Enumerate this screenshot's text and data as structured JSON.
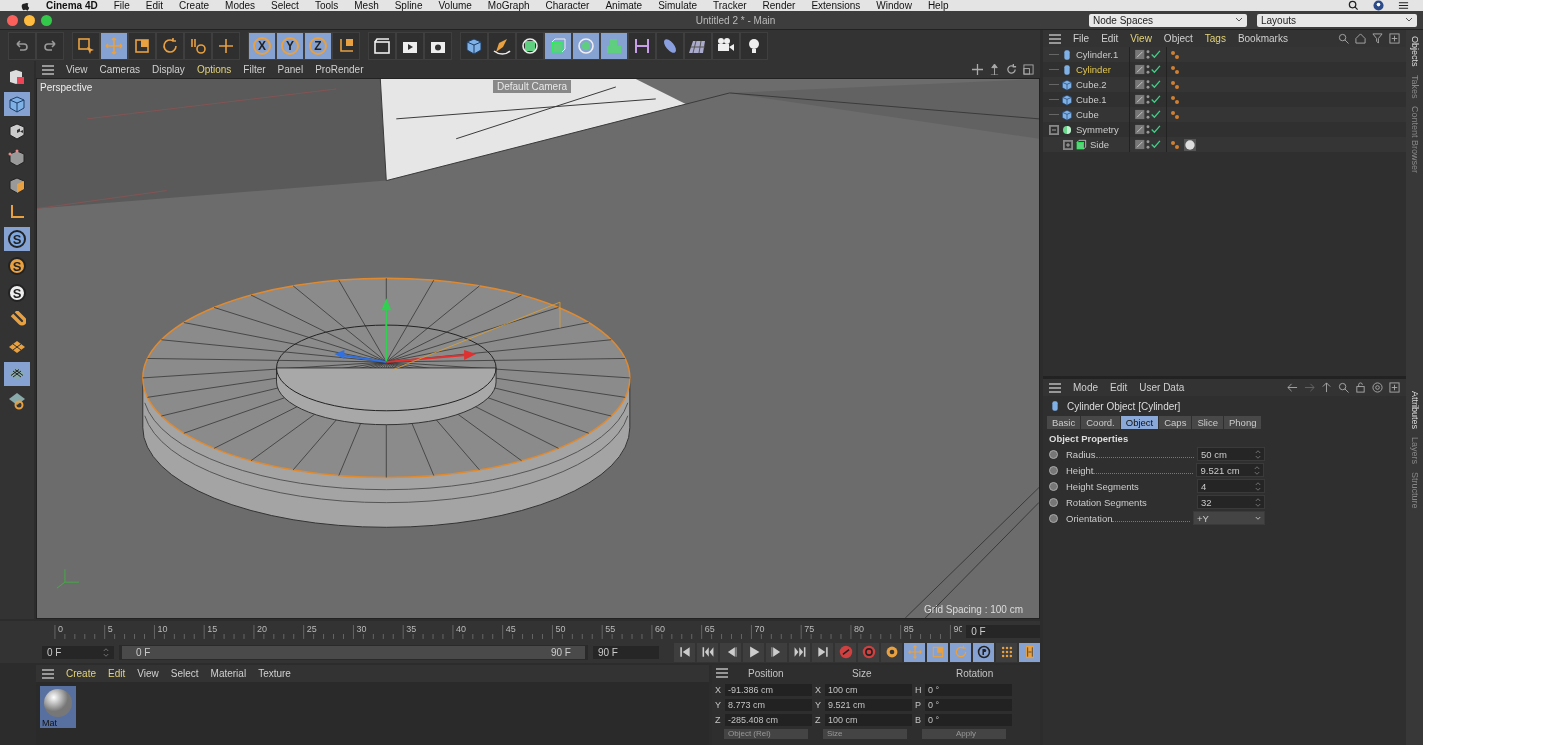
{
  "menubar": {
    "app": "Cinema 4D",
    "menus": [
      "File",
      "Edit",
      "Create",
      "Modes",
      "Select",
      "Tools",
      "Mesh",
      "Spline",
      "Volume",
      "MoGraph",
      "Character",
      "Animate",
      "Simulate",
      "Tracker",
      "Render",
      "Extensions",
      "Window",
      "Help"
    ]
  },
  "window": {
    "title": "Untitled 2 * - Main"
  },
  "node_spaces": "Node Spaces",
  "layouts": "Layouts",
  "toolbar": [
    [
      {
        "kind": "undo",
        "selected": false
      },
      {
        "kind": "redo",
        "selected": false
      }
    ],
    [
      {
        "kind": "select",
        "selected": false
      },
      {
        "kind": "move",
        "selected": true
      },
      {
        "kind": "scale",
        "selected": false
      },
      {
        "kind": "rotate",
        "selected": false
      },
      {
        "kind": "psr",
        "selected": false
      },
      {
        "kind": "add",
        "selected": false
      }
    ],
    [
      {
        "kind": "axis",
        "label": "X",
        "selected": true
      },
      {
        "kind": "axis",
        "label": "Y",
        "selected": true
      },
      {
        "kind": "axis",
        "label": "Z",
        "selected": true
      },
      {
        "kind": "coord",
        "selected": false
      }
    ],
    [
      {
        "kind": "clapper",
        "selected": false
      },
      {
        "kind": "render",
        "selected": false
      },
      {
        "kind": "render-settings",
        "selected": false
      }
    ],
    [
      {
        "kind": "cube",
        "selected": false
      },
      {
        "kind": "pen",
        "selected": false
      },
      {
        "kind": "subdiv",
        "selected": false
      },
      {
        "kind": "extrude",
        "selected": true
      },
      {
        "kind": "mograph",
        "selected": true
      },
      {
        "kind": "cloner",
        "selected": true
      },
      {
        "kind": "deformer",
        "selected": false
      },
      {
        "kind": "field",
        "selected": false
      },
      {
        "kind": "floor",
        "selected": false
      },
      {
        "kind": "camera",
        "selected": false
      },
      {
        "kind": "light",
        "selected": false
      }
    ]
  ],
  "left_tools": [
    {
      "kind": "editable",
      "selected": false
    },
    {
      "kind": "cube",
      "selected": true
    },
    {
      "kind": "texture",
      "selected": false
    },
    {
      "kind": "points",
      "selected": false
    },
    {
      "kind": "polygons",
      "selected": false
    },
    {
      "kind": "corner",
      "selected": false
    },
    {
      "kind": "snap",
      "label": "S",
      "selected": true
    },
    {
      "kind": "snap",
      "label": "S",
      "selected": false
    },
    {
      "kind": "snap",
      "label": "S",
      "selected": false
    },
    {
      "kind": "magnet",
      "selected": false
    },
    {
      "kind": "workplane",
      "selected": false
    },
    {
      "kind": "grid",
      "selected": true
    },
    {
      "kind": "lock",
      "selected": false
    }
  ],
  "viewport": {
    "menus": [
      {
        "label": "View",
        "active": false
      },
      {
        "label": "Cameras",
        "active": false
      },
      {
        "label": "Display",
        "active": false
      },
      {
        "label": "Options",
        "active": true
      },
      {
        "label": "Filter",
        "active": false
      },
      {
        "label": "Panel",
        "active": false
      },
      {
        "label": "ProRender",
        "active": false
      }
    ],
    "name": "Perspective",
    "camera": "Default Camera",
    "grid_spacing": "Grid Spacing : 100 cm"
  },
  "timeline": {
    "ticks": [
      "0",
      "5",
      "10",
      "15",
      "20",
      "25",
      "30",
      "35",
      "40",
      "45",
      "50",
      "55",
      "60",
      "65",
      "70",
      "75",
      "80",
      "85",
      "90"
    ],
    "current": "0 F",
    "start": "0 F",
    "range": {
      "level": 1
    },
    "range_start": "0 F",
    "range_end": "90 F",
    "end": "90 F",
    "controls": [
      {
        "kind": "first",
        "selected": false
      },
      {
        "kind": "prev-key",
        "selected": false
      },
      {
        "kind": "prev",
        "selected": false
      },
      {
        "kind": "play",
        "selected": false
      },
      {
        "kind": "next",
        "selected": false
      },
      {
        "kind": "next-key",
        "selected": false
      },
      {
        "kind": "last",
        "selected": false
      },
      {
        "kind": "record",
        "selected": false
      },
      {
        "kind": "autokey",
        "selected": false
      },
      {
        "kind": "keysel",
        "selected": false
      },
      {
        "kind": "move",
        "selected": true
      },
      {
        "kind": "scale",
        "selected": true
      },
      {
        "kind": "rotate",
        "selected": true
      },
      {
        "kind": "param",
        "selected": true
      },
      {
        "kind": "dots",
        "selected": false
      },
      {
        "kind": "film",
        "selected": true
      }
    ]
  },
  "material": {
    "menus": [
      {
        "label": "Create",
        "active": true
      },
      {
        "label": "Edit",
        "active": true
      },
      {
        "label": "View",
        "active": false
      },
      {
        "label": "Select",
        "active": false
      },
      {
        "label": "Material",
        "active": false
      },
      {
        "label": "Texture",
        "active": false
      }
    ],
    "materials": [
      {
        "name": "Mat",
        "selected": true
      }
    ]
  },
  "coordinates": {
    "headers": [
      "Position",
      "Size",
      "Rotation"
    ],
    "rows": [
      {
        "cells": [
          {
            "axis": "X",
            "value": "-91.386 cm"
          },
          {
            "axis": "X",
            "value": "100 cm"
          },
          {
            "axis": "H",
            "value": "0 °"
          }
        ]
      },
      {
        "cells": [
          {
            "axis": "Y",
            "value": "8.773 cm"
          },
          {
            "axis": "Y",
            "value": "9.521 cm"
          },
          {
            "axis": "P",
            "value": "0 °"
          }
        ]
      },
      {
        "cells": [
          {
            "axis": "Z",
            "value": "-285.408 cm"
          },
          {
            "axis": "Z",
            "value": "100 cm"
          },
          {
            "axis": "B",
            "value": "0 °"
          }
        ]
      }
    ],
    "footer": [
      "Object (Rel)",
      "Size",
      "Apply"
    ]
  },
  "objects": {
    "menus": [
      {
        "label": "File",
        "active": false
      },
      {
        "label": "Edit",
        "active": false
      },
      {
        "label": "View",
        "active": true
      },
      {
        "label": "Object",
        "active": false
      },
      {
        "label": "Tags",
        "active": true
      },
      {
        "label": "Bookmarks",
        "active": false
      }
    ],
    "items": [
      {
        "name": "Cylinder.1",
        "kind": "cylinder",
        "selected": false,
        "phong_tag": true,
        "material_tag": false
      },
      {
        "name": "Cylinder",
        "kind": "cylinder",
        "selected": true,
        "phong_tag": true,
        "material_tag": false
      },
      {
        "name": "Cube.2",
        "kind": "cube",
        "selected": false,
        "phong_tag": true,
        "material_tag": false
      },
      {
        "name": "Cube.1",
        "kind": "cube",
        "selected": false,
        "phong_tag": true,
        "material_tag": false
      },
      {
        "name": "Cube",
        "kind": "cube",
        "selected": false,
        "phong_tag": true,
        "material_tag": false
      },
      {
        "name": "Symmetry",
        "kind": "symmetry",
        "selected": false,
        "expanded": true,
        "phong_tag": false,
        "material_tag": false,
        "children": [
          {
            "name": "Side",
            "kind": "extrude",
            "selected": false,
            "expanded": false,
            "phong_tag": true,
            "material_tag": true
          }
        ]
      }
    ]
  },
  "attributes": {
    "menus": [
      "Mode",
      "Edit",
      "User Data"
    ],
    "title": "Cylinder Object [Cylinder]",
    "tabs": [
      {
        "label": "Basic",
        "selected": false
      },
      {
        "label": "Coord.",
        "selected": false
      },
      {
        "label": "Object",
        "selected": true
      },
      {
        "label": "Caps",
        "selected": false
      },
      {
        "label": "Slice",
        "selected": false
      },
      {
        "label": "Phong",
        "selected": false
      }
    ],
    "section": "Object Properties",
    "params": [
      {
        "label": "Radius",
        "value": "50 cm",
        "kind": "number",
        "leader": true
      },
      {
        "label": "Height",
        "value": "9.521 cm",
        "kind": "number",
        "leader": true
      },
      {
        "label": "Height Segments",
        "value": "4",
        "kind": "number",
        "leader": false
      },
      {
        "label": "Rotation Segments",
        "value": "32",
        "kind": "number",
        "leader": false
      },
      {
        "label": "Orientation",
        "value": "+Y",
        "kind": "dropdown",
        "leader": true
      }
    ]
  },
  "side_tabs": {
    "top": [
      {
        "label": "Objects",
        "selected": true
      },
      {
        "label": "Takes",
        "selected": false
      },
      {
        "label": "Content Browser",
        "selected": false
      }
    ],
    "bottom": [
      {
        "label": "Attributes",
        "selected": true
      },
      {
        "label": "Layers",
        "selected": false
      },
      {
        "label": "Structure",
        "selected": false
      }
    ]
  }
}
